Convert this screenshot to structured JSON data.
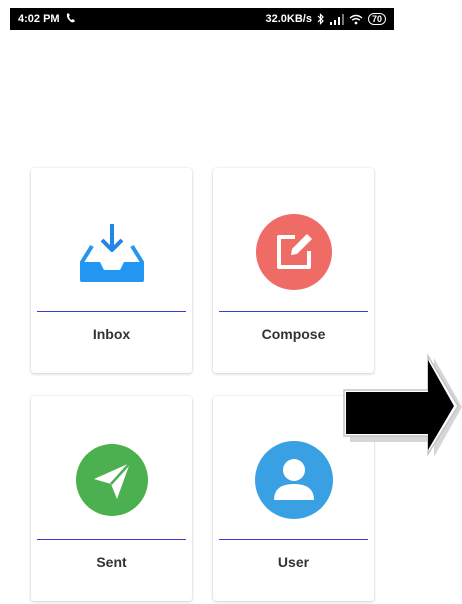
{
  "status_bar": {
    "time": "4:02 PM",
    "speed": "32.0KB/s",
    "battery": "70"
  },
  "tiles": [
    {
      "label": "Inbox",
      "icon": "inbox-icon",
      "color": "#2196f3"
    },
    {
      "label": "Compose",
      "icon": "compose-icon",
      "color": "#ef6c66"
    },
    {
      "label": "Sent",
      "icon": "paper-plane-icon",
      "color": "#4caf50"
    },
    {
      "label": "User",
      "icon": "user-icon",
      "color": "#3aa0e4"
    }
  ],
  "colors": {
    "divider": "#3d3ddd",
    "arrow": "#000000"
  }
}
